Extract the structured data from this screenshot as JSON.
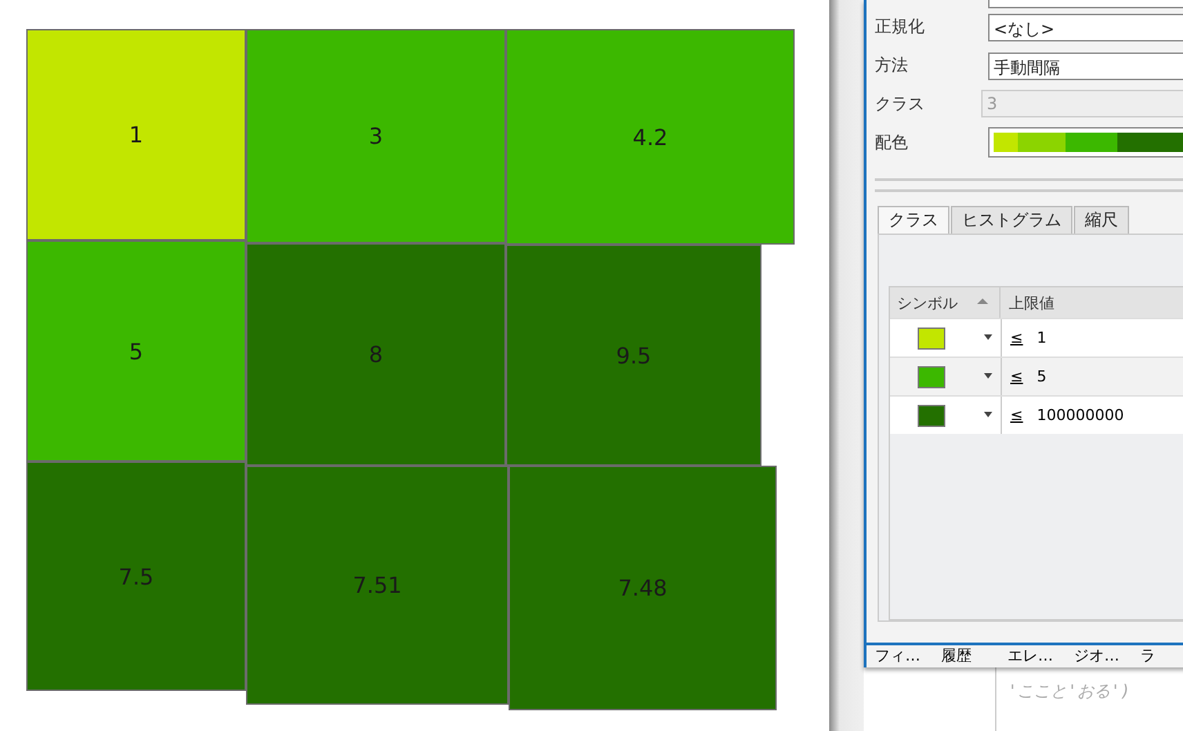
{
  "map": {
    "polygons": [
      {
        "label": "1",
        "color": "#c2e600"
      },
      {
        "label": "3",
        "color": "#3cb800"
      },
      {
        "label": "4.2",
        "color": "#3cb800"
      },
      {
        "label": "5",
        "color": "#3cb800"
      },
      {
        "label": "8",
        "color": "#237000"
      },
      {
        "label": "9.5",
        "color": "#237000"
      },
      {
        "label": "7.5",
        "color": "#237000"
      },
      {
        "label": "7.51",
        "color": "#237000"
      },
      {
        "label": "7.48",
        "color": "#237000"
      }
    ]
  },
  "panel": {
    "fields": [
      {
        "kind": "dropdown",
        "label": "正規化",
        "value": "<なし>",
        "disabled": false
      },
      {
        "kind": "dropdown",
        "label": "方法",
        "value": "手動間隔",
        "disabled": false
      },
      {
        "kind": "text",
        "label": "クラス",
        "placeholder": "3",
        "disabled": true
      },
      {
        "kind": "ramp",
        "label": "配色"
      }
    ],
    "tabs": [
      {
        "label": "クラス",
        "selected": true
      },
      {
        "label": "ヒストグラム",
        "selected": false
      },
      {
        "label": "縮尺",
        "selected": false
      }
    ],
    "table": {
      "columns": [
        "シンボル",
        "上限値"
      ],
      "rows": [
        {
          "color": "#c2e600",
          "op": "≤",
          "value": "1"
        },
        {
          "color": "#3cb800",
          "op": "≤",
          "value": "5"
        },
        {
          "color": "#237000",
          "op": "≤",
          "value": "100000000"
        }
      ]
    },
    "bottom_tabs": [
      "フィ…",
      "履歴",
      "エレ…",
      "ジオ…",
      "ラ"
    ]
  },
  "code_lines": [
    "'ここと'おる')"
  ]
}
